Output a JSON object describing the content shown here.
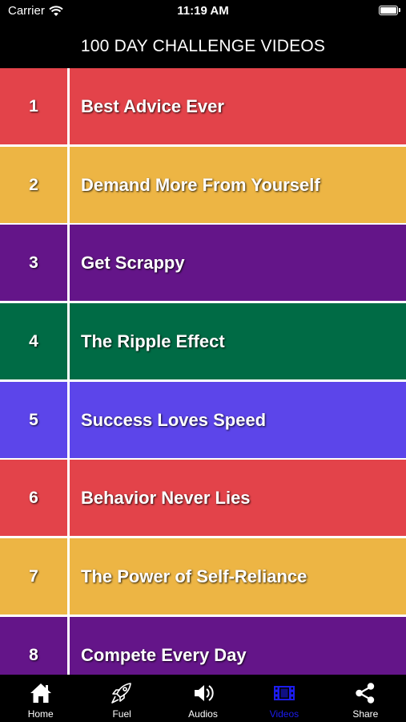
{
  "status_bar": {
    "carrier": "Carrier",
    "time": "11:19 AM"
  },
  "header": {
    "title": "100 DAY CHALLENGE VIDEOS"
  },
  "videos": [
    {
      "number": "1",
      "title": "Best Advice Ever",
      "color": "#e3434a"
    },
    {
      "number": "2",
      "title": "Demand More From Yourself",
      "color": "#edb544"
    },
    {
      "number": "3",
      "title": "Get Scrappy",
      "color": "#641589"
    },
    {
      "number": "4",
      "title": "The Ripple Effect",
      "color": "#006b45"
    },
    {
      "number": "5",
      "title": "Success Loves Speed",
      "color": "#5c45ea"
    },
    {
      "number": "6",
      "title": "Behavior Never Lies",
      "color": "#e3434a"
    },
    {
      "number": "7",
      "title": "The Power of Self-Reliance",
      "color": "#edb544"
    },
    {
      "number": "8",
      "title": "Compete Every Day",
      "color": "#641589"
    }
  ],
  "tabs": [
    {
      "label": "Home",
      "icon": "home-icon"
    },
    {
      "label": "Fuel",
      "icon": "rocket-icon"
    },
    {
      "label": "Audios",
      "icon": "speaker-icon"
    },
    {
      "label": "Videos",
      "icon": "video-icon",
      "active": true
    },
    {
      "label": "Share",
      "icon": "share-icon"
    }
  ],
  "colors": {
    "bar_background": "#000000",
    "active_tab": "#1c1cf0",
    "divider": "#ffffff"
  }
}
